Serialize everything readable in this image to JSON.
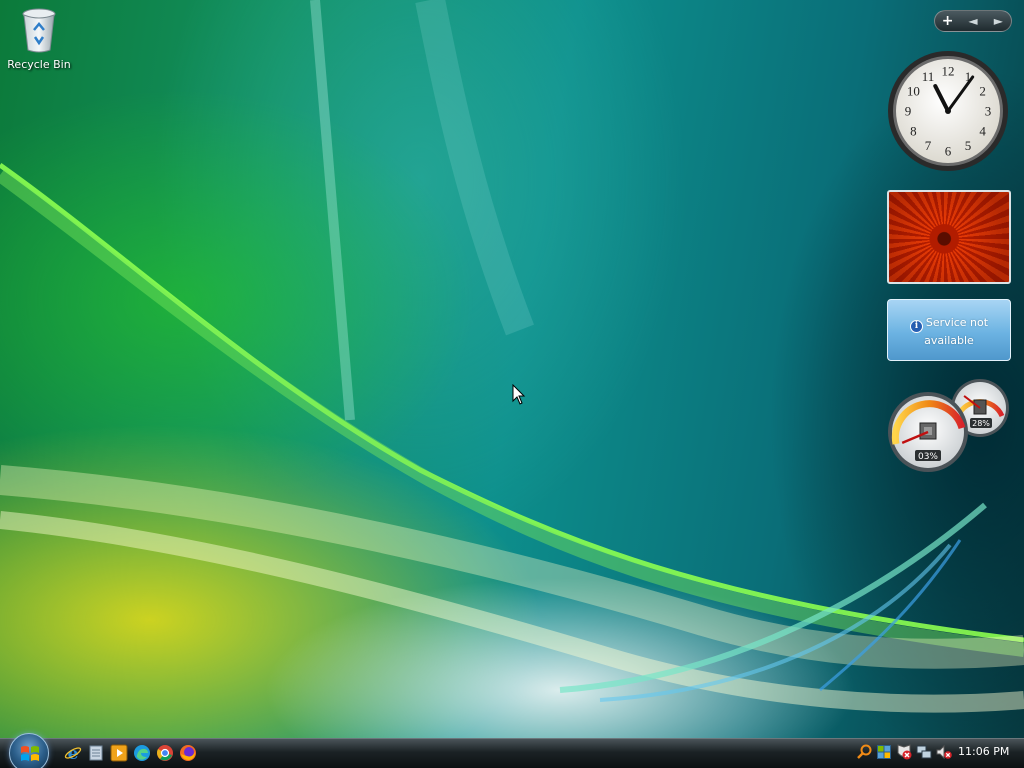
{
  "desktop": {
    "icons": [
      {
        "label": "Recycle Bin",
        "icon": "recycle-bin-icon"
      }
    ]
  },
  "sidebar": {
    "controls": {
      "add": "+",
      "prev": "◄",
      "next": "►"
    },
    "gadgets": {
      "clock": {
        "numerals": [
          "12",
          "1",
          "2",
          "3",
          "4",
          "5",
          "6",
          "7",
          "8",
          "9",
          "10",
          "11"
        ],
        "time": {
          "hour": 11,
          "minute": 6
        }
      },
      "slideshow": {
        "subject": "red flower"
      },
      "weather": {
        "message": "Service not available",
        "icon": "info-icon"
      },
      "cpu_meter": {
        "cpu_percent_label": "03%",
        "memory_percent_label": "28%",
        "cpu_percent": 3,
        "memory_percent": 28
      }
    }
  },
  "taskbar": {
    "start": {
      "icon": "windows-flag-icon"
    },
    "quick_launch": [
      {
        "name": "internet-explorer-icon",
        "color": "#2d8cd6"
      },
      {
        "name": "show-desktop-icon",
        "color": "#c9d6e3"
      },
      {
        "name": "media-player-icon",
        "color": "#f0a31a"
      },
      {
        "name": "edge-icon",
        "color": "#1c9be0"
      },
      {
        "name": "chrome-icon",
        "color": "#e8b21b"
      },
      {
        "name": "firefox-icon",
        "color": "#f26b22"
      }
    ],
    "tray": [
      {
        "name": "search-icon",
        "color": "#f08a16"
      },
      {
        "name": "windows-defender-icon",
        "color": "#5aa3d8"
      },
      {
        "name": "security-alert-icon",
        "color": "#d8232a"
      },
      {
        "name": "network-icon",
        "color": "#c0d3e0"
      },
      {
        "name": "volume-muted-icon",
        "color": "#d8232a"
      }
    ],
    "time": "11:06 PM"
  }
}
